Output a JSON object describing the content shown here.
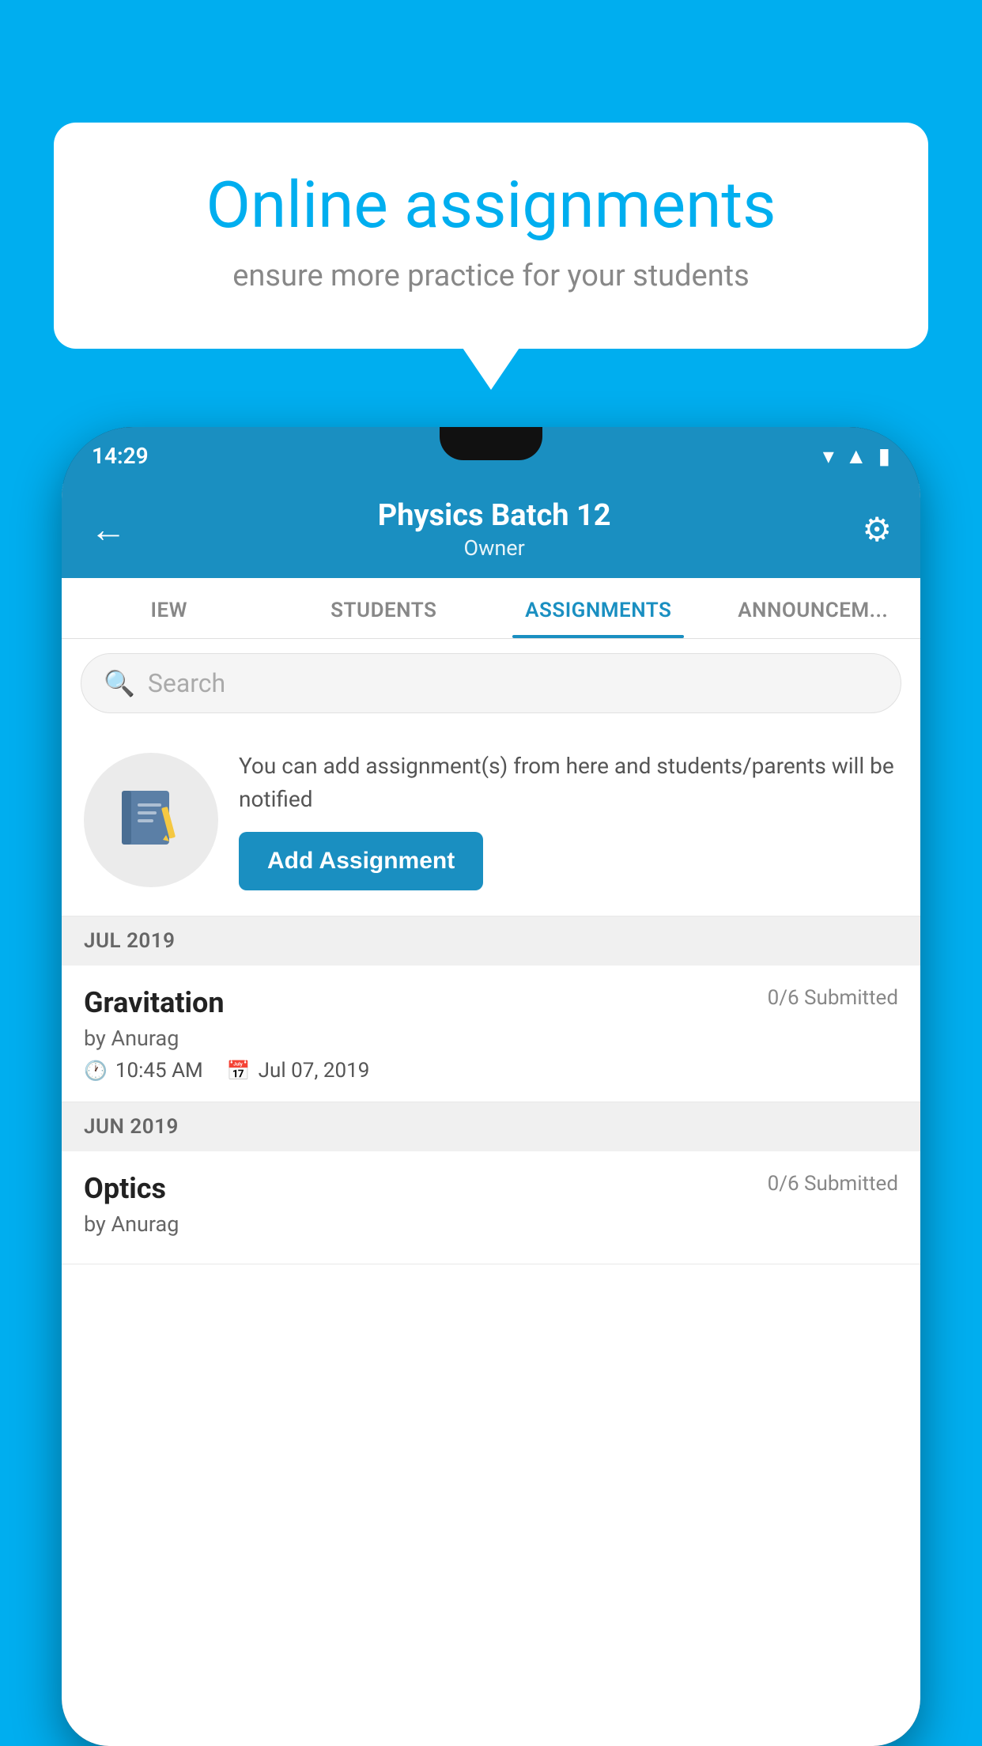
{
  "background_color": "#00AEEF",
  "speech_bubble": {
    "title": "Online assignments",
    "subtitle": "ensure more practice for your students"
  },
  "phone": {
    "status_bar": {
      "time": "14:29",
      "icons": [
        "wifi",
        "signal",
        "battery"
      ]
    },
    "header": {
      "title": "Physics Batch 12",
      "subtitle": "Owner",
      "back_label": "←",
      "settings_label": "⚙"
    },
    "tabs": [
      {
        "label": "IEW",
        "active": false
      },
      {
        "label": "STUDENTS",
        "active": false
      },
      {
        "label": "ASSIGNMENTS",
        "active": true
      },
      {
        "label": "ANNOUNCEM...",
        "active": false
      }
    ],
    "search": {
      "placeholder": "Search"
    },
    "promo": {
      "description": "You can add assignment(s) from here and students/parents will be notified",
      "button_label": "Add Assignment"
    },
    "sections": [
      {
        "month_label": "JUL 2019",
        "assignments": [
          {
            "name": "Gravitation",
            "submitted": "0/6 Submitted",
            "by": "by Anurag",
            "time": "10:45 AM",
            "date": "Jul 07, 2019"
          }
        ]
      },
      {
        "month_label": "JUN 2019",
        "assignments": [
          {
            "name": "Optics",
            "submitted": "0/6 Submitted",
            "by": "by Anurag",
            "time": "",
            "date": ""
          }
        ]
      }
    ]
  }
}
